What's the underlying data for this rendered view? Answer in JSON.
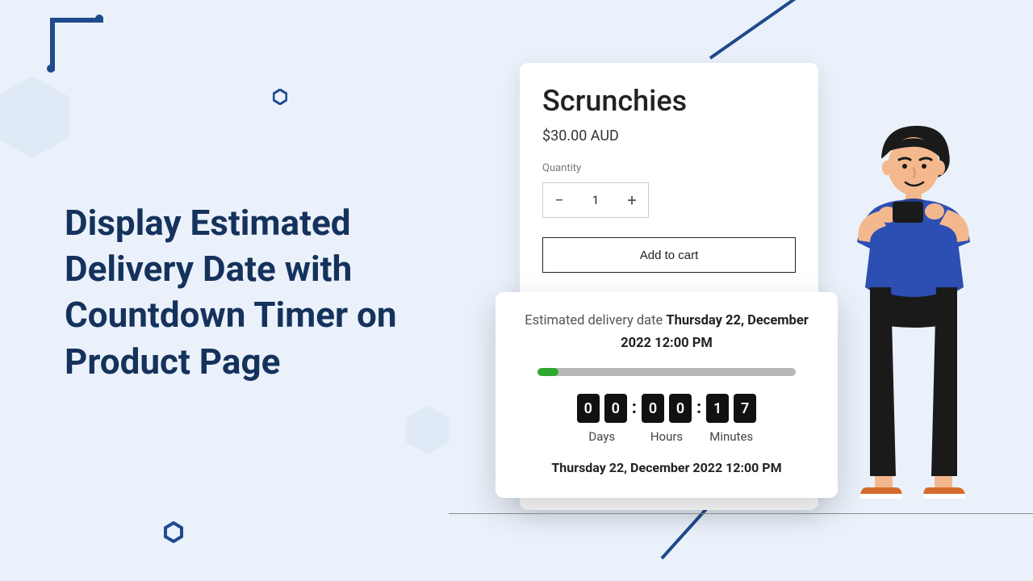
{
  "headline": "Display Estimated Delivery Date with Countdown Timer on Product Page",
  "product": {
    "title": "Scrunchies",
    "price": "$30.00 AUD",
    "quantity_label": "Quantity",
    "quantity_value": "1",
    "minus": "−",
    "plus": "+",
    "add_to_cart": "Add to cart"
  },
  "delivery": {
    "prefix": "Estimated delivery date ",
    "date_bold": "Thursday 22, December 2022 12:00 PM",
    "progress_percent": 8,
    "countdown": {
      "days": [
        "0",
        "0"
      ],
      "hours": [
        "0",
        "0"
      ],
      "minutes": [
        "1",
        "7"
      ],
      "days_label": "Days",
      "hours_label": "Hours",
      "minutes_label": "Minutes",
      "colon": ":"
    },
    "full_date": "Thursday 22, December 2022 12:00 PM"
  }
}
